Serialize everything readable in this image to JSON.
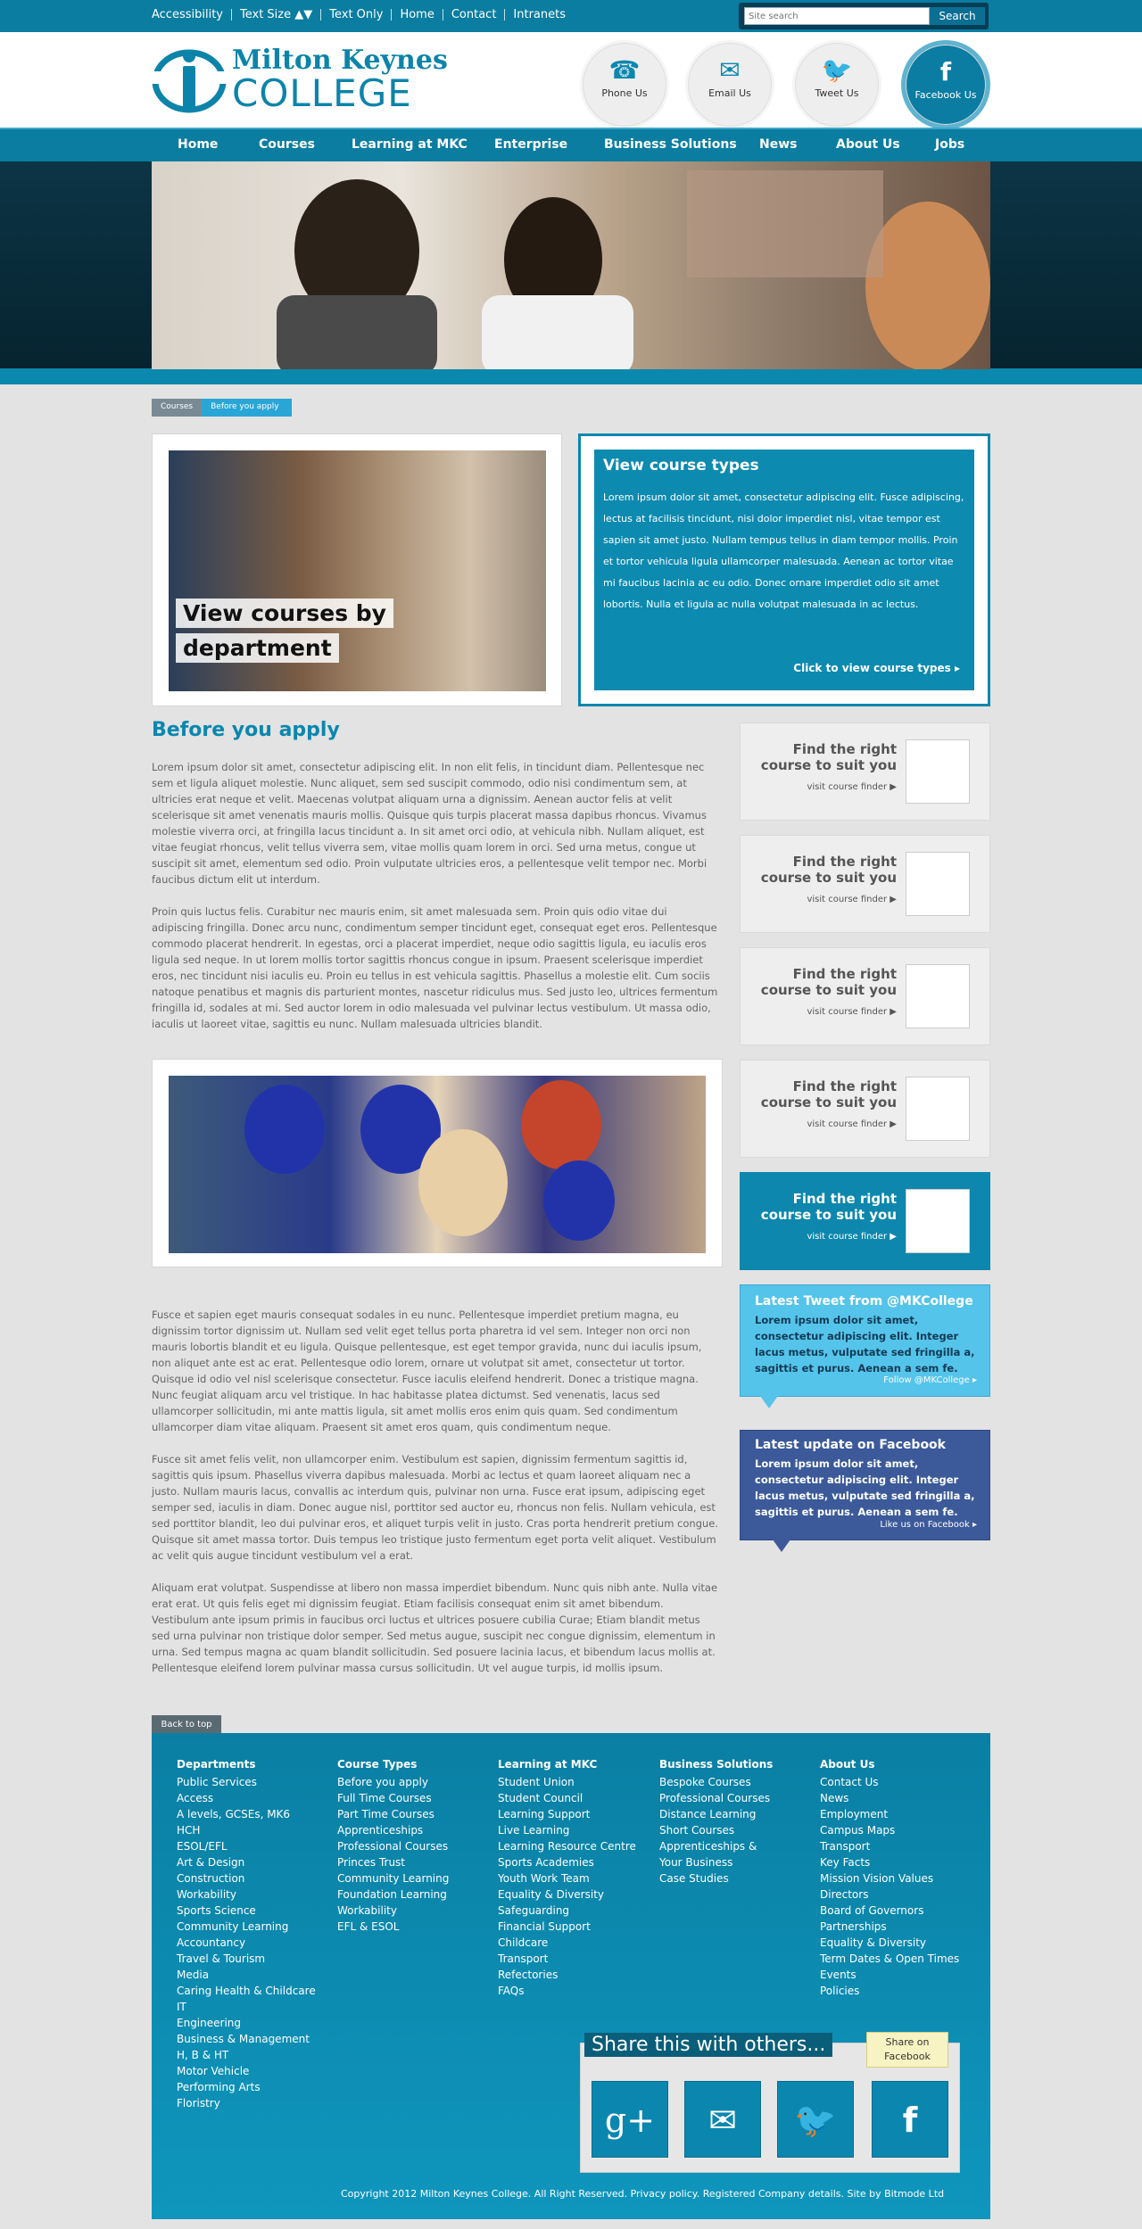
{
  "topbar": {
    "links": [
      "Accessibility",
      "Text Size ▲▼",
      "Text Only",
      "Home",
      "Contact",
      "Intranets"
    ],
    "search_placeholder": "Site search",
    "search_button": "Search"
  },
  "logo": {
    "line1": "Milton Keynes",
    "line2": "COLLEGE"
  },
  "header_actions": [
    {
      "label": "Phone Us",
      "icon": "phone-icon"
    },
    {
      "label": "Email Us",
      "icon": "email-icon"
    },
    {
      "label": "Tweet Us",
      "icon": "twitter-icon"
    },
    {
      "label": "Facebook Us",
      "icon": "facebook-icon"
    }
  ],
  "nav": [
    "Home",
    "Courses",
    "Learning at MKC",
    "Enterprise",
    "Business Solutions",
    "News",
    "About Us",
    "Jobs"
  ],
  "breadcrumb": [
    "Courses",
    "Before you apply"
  ],
  "promo_left": {
    "line1": "View courses by",
    "line2": "department"
  },
  "promo_right": {
    "title": "View course types",
    "text": "Lorem ipsum dolor sit amet, consectetur adipiscing elit. Fusce adipiscing, lectus at facilisis tincidunt, nisi dolor imperdiet nisl, vitae tempor est sapien sit amet justo. Nullam tempus tellus in diam tempor mollis. Proin et tortor vehicula ligula ullamcorper malesuada. Aenean ac tortor vitae mi faucibus lacinia ac eu odio. Donec ornare imperdiet odio sit amet lobortis. Nulla et ligula ac nulla volutpat malesuada in ac lectus.",
    "cta": "Click to view course types ▸"
  },
  "main": {
    "heading": "Before you apply",
    "p1": "Lorem ipsum dolor sit amet, consectetur adipiscing elit. In non elit felis, in tincidunt diam. Pellentesque nec sem et ligula aliquet molestie. Nunc aliquet, sem sed suscipit commodo, odio nisi condimentum sem, at ultricies erat neque et velit. Maecenas volutpat aliquam urna a dignissim. Aenean auctor felis at velit scelerisque sit amet venenatis mauris mollis. Quisque quis turpis placerat massa dapibus rhoncus. Vivamus molestie viverra orci, at fringilla lacus tincidunt a. In sit amet orci odio, at vehicula nibh. Nullam aliquet, est vitae feugiat rhoncus, velit tellus viverra sem, vitae mollis quam lorem in orci. Sed urna metus, congue ut suscipit sit amet, elementum sed odio. Proin vulputate ultricies eros, a pellentesque velit tempor nec. Morbi faucibus dictum elit ut interdum.",
    "p2": "Proin quis luctus felis. Curabitur nec mauris enim, sit amet malesuada sem. Proin quis odio vitae dui adipiscing fringilla. Donec arcu nunc, condimentum semper tincidunt eget, consequat eget eros. Pellentesque commodo placerat hendrerit. In egestas, orci a placerat imperdiet, neque odio sagittis ligula, eu iaculis eros ligula sed neque. In ut lorem mollis tortor sagittis rhoncus congue in ipsum. Praesent scelerisque imperdiet eros, nec tincidunt nisi iaculis eu. Proin eu tellus in est vehicula sagittis. Phasellus a molestie elit. Cum sociis natoque penatibus et magnis dis parturient montes, nascetur ridiculus mus. Sed justo leo, ultrices fermentum fringilla id, sodales at mi. Sed auctor lorem in odio malesuada vel pulvinar lectus vestibulum. Ut massa odio, iaculis ut laoreet vitae, sagittis eu nunc. Nullam malesuada ultricies blandit.",
    "p3": "Fusce et sapien eget mauris consequat sodales in eu nunc. Pellentesque imperdiet pretium magna, eu dignissim tortor dignissim ut. Nullam sed velit eget tellus porta pharetra id vel sem. Integer non orci non mauris lobortis blandit et eu ligula. Quisque pellentesque, est eget tempor gravida, nunc dui iaculis ipsum, non aliquet ante est ac erat. Pellentesque odio lorem, ornare ut volutpat sit amet, consectetur ut tortor. Quisque id odio vel nisl scelerisque consectetur. Fusce iaculis eleifend hendrerit. Donec a tristique magna. Nunc feugiat aliquam arcu vel tristique. In hac habitasse platea dictumst. Sed venenatis, lacus sed ullamcorper sollicitudin, mi ante mattis ligula, sit amet mollis eros enim quis quam. Sed condimentum ullamcorper diam vitae aliquam. Praesent sit amet eros quam, quis condimentum neque.",
    "p4": "Fusce sit amet felis velit, non ullamcorper enim. Vestibulum est sapien, dignissim fermentum sagittis id, sagittis quis ipsum. Phasellus viverra dapibus malesuada. Morbi ac lectus et quam laoreet aliquam nec a justo. Nullam mauris lacus, convallis ac interdum quis, pulvinar non urna. Fusce erat ipsum, adipiscing eget semper sed, iaculis in diam. Donec augue nisl, porttitor sed auctor eu, rhoncus non felis. Nullam vehicula, est sed porttitor blandit, leo dui pulvinar eros, et aliquet turpis velit in justo. Cras porta hendrerit pretium congue. Quisque sit amet massa tortor. Duis tempus leo tristique justo fermentum eget porta velit aliquet. Vestibulum ac velit quis augue tincidunt vestibulum vel a erat.",
    "p5": "Aliquam erat volutpat. Suspendisse at libero non massa imperdiet bibendum. Nunc quis nibh ante. Nulla vitae erat erat. Ut quis felis eget mi dignissim feugiat. Etiam facilisis consequat enim sit amet bibendum. Vestibulum ante ipsum primis in faucibus orci luctus et ultrices posuere cubilia Curae; Etiam blandit metus sed urna pulvinar non tristique dolor semper. Sed metus augue, suscipit nec congue dignissim, elementum in urna. Sed tempus magna ac quam blandit sollicitudin. Sed posuere lacinia lacus, et bibendum lacus mollis at. Pellentesque eleifend lorem pulvinar massa cursus sollicitudin. Ut vel augue turpis, id mollis ipsum."
  },
  "finder": {
    "title": "Find the right course to suit you",
    "link": "visit course finder ▶"
  },
  "tweet": {
    "title": "Latest Tweet from @MKCollege",
    "text": "Lorem ipsum dolor sit amet, consectetur adipiscing elit. Integer lacus metus, vulputate sed fringilla a, sagittis et purus. Aenean a sem fe.",
    "link": "Follow @MKCollege ▸"
  },
  "facebook": {
    "title": "Latest update on Facebook",
    "text": "Lorem ipsum dolor sit amet, consectetur adipiscing elit. Integer lacus metus, vulputate sed fringilla a, sagittis et purus. Aenean a sem fe.",
    "link": "Like us on Facebook ▸"
  },
  "back_to_top": "Back to top",
  "footer": {
    "columns": [
      {
        "title": "Departments",
        "items": [
          "Public Services",
          "Access",
          "A levels, GCSEs, MK6",
          "HCH",
          "ESOL/EFL",
          "Art & Design",
          "Construction",
          "Workability",
          "Sports Science",
          "Community Learning",
          "Accountancy",
          "Travel & Tourism",
          "Media",
          "Caring Health & Childcare",
          "IT",
          "Engineering",
          "Business & Management",
          "H, B & HT",
          "Motor Vehicle",
          "Performing Arts",
          "Floristry"
        ]
      },
      {
        "title": "Course Types",
        "items": [
          "Before you apply",
          "Full Time Courses",
          "Part Time Courses",
          "Apprenticeships",
          "Professional Courses",
          "Princes Trust",
          "Community Learning",
          "Foundation Learning",
          "Workability",
          "EFL & ESOL"
        ]
      },
      {
        "title": "Learning at MKC",
        "items": [
          "Student Union",
          "Student Council",
          "Learning Support",
          "Live Learning",
          "Learning Resource Centre",
          "Sports Academies",
          "Youth Work Team",
          "Equality & Diversity",
          "Safeguarding",
          "Financial Support",
          "Childcare",
          "Transport",
          "Refectories",
          "FAQs"
        ]
      },
      {
        "title": "Business Solutions",
        "items": [
          "Bespoke Courses",
          "Professional Courses",
          "Distance Learning",
          "Short Courses",
          "Apprenticeships & Your Business",
          "Case Studies"
        ]
      },
      {
        "title": "About Us",
        "items": [
          "Contact Us",
          "News",
          "Employment",
          "Campus Maps",
          "Transport",
          "Key Facts",
          "Mission Vision Values",
          "Directors",
          "Board of Governors",
          "Partnerships",
          "Equality & Diversity",
          "Term Dates & Open Times",
          "Events",
          "Policies"
        ]
      }
    ],
    "share_title": "Share this with others...",
    "share_bubble": "Share on Facebook",
    "copyright": "Copyright 2012 Milton Keynes College. All Right Reserved. Privacy policy. Registered Company details. Site by Bitmode Ltd"
  }
}
